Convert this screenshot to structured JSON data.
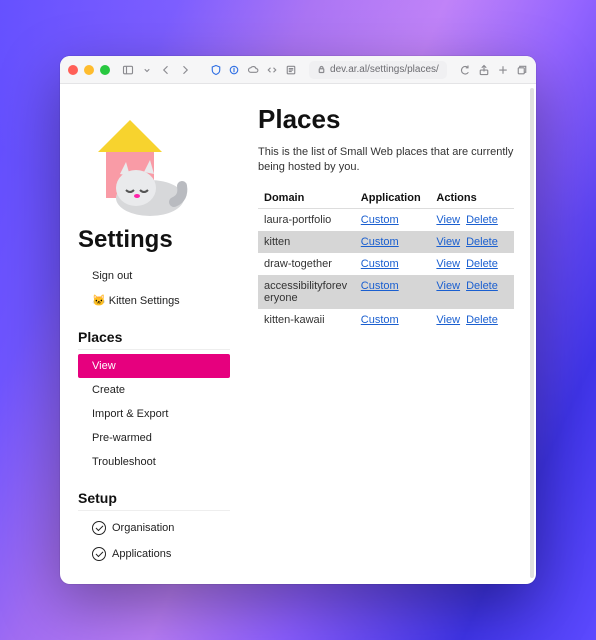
{
  "address_bar": {
    "url": "dev.ar.al/settings/places/"
  },
  "sidebar": {
    "title": "Settings",
    "top_items": [
      {
        "label": "Sign out"
      },
      {
        "label": "🐱 Kitten Settings"
      }
    ],
    "places_section": "Places",
    "places_items": [
      {
        "label": "View",
        "active": true
      },
      {
        "label": "Create"
      },
      {
        "label": "Import & Export"
      },
      {
        "label": "Pre-warmed"
      },
      {
        "label": "Troubleshoot"
      }
    ],
    "setup_section": "Setup",
    "setup_items": [
      {
        "label": "Organisation"
      },
      {
        "label": "Applications"
      }
    ]
  },
  "page": {
    "title": "Places",
    "description": "This is the list of Small Web places that are currently being hosted by you."
  },
  "table": {
    "headers": {
      "domain": "Domain",
      "app": "Application",
      "actions": "Actions"
    },
    "action_labels": {
      "view": "View",
      "delete": "Delete"
    },
    "rows": [
      {
        "domain": "laura-portfolio",
        "app": "Custom"
      },
      {
        "domain": "kitten",
        "app": "Custom"
      },
      {
        "domain": "draw-together",
        "app": "Custom"
      },
      {
        "domain": "accessibilityforeveryone",
        "app": "Custom"
      },
      {
        "domain": "kitten-kawaii",
        "app": "Custom"
      }
    ]
  }
}
